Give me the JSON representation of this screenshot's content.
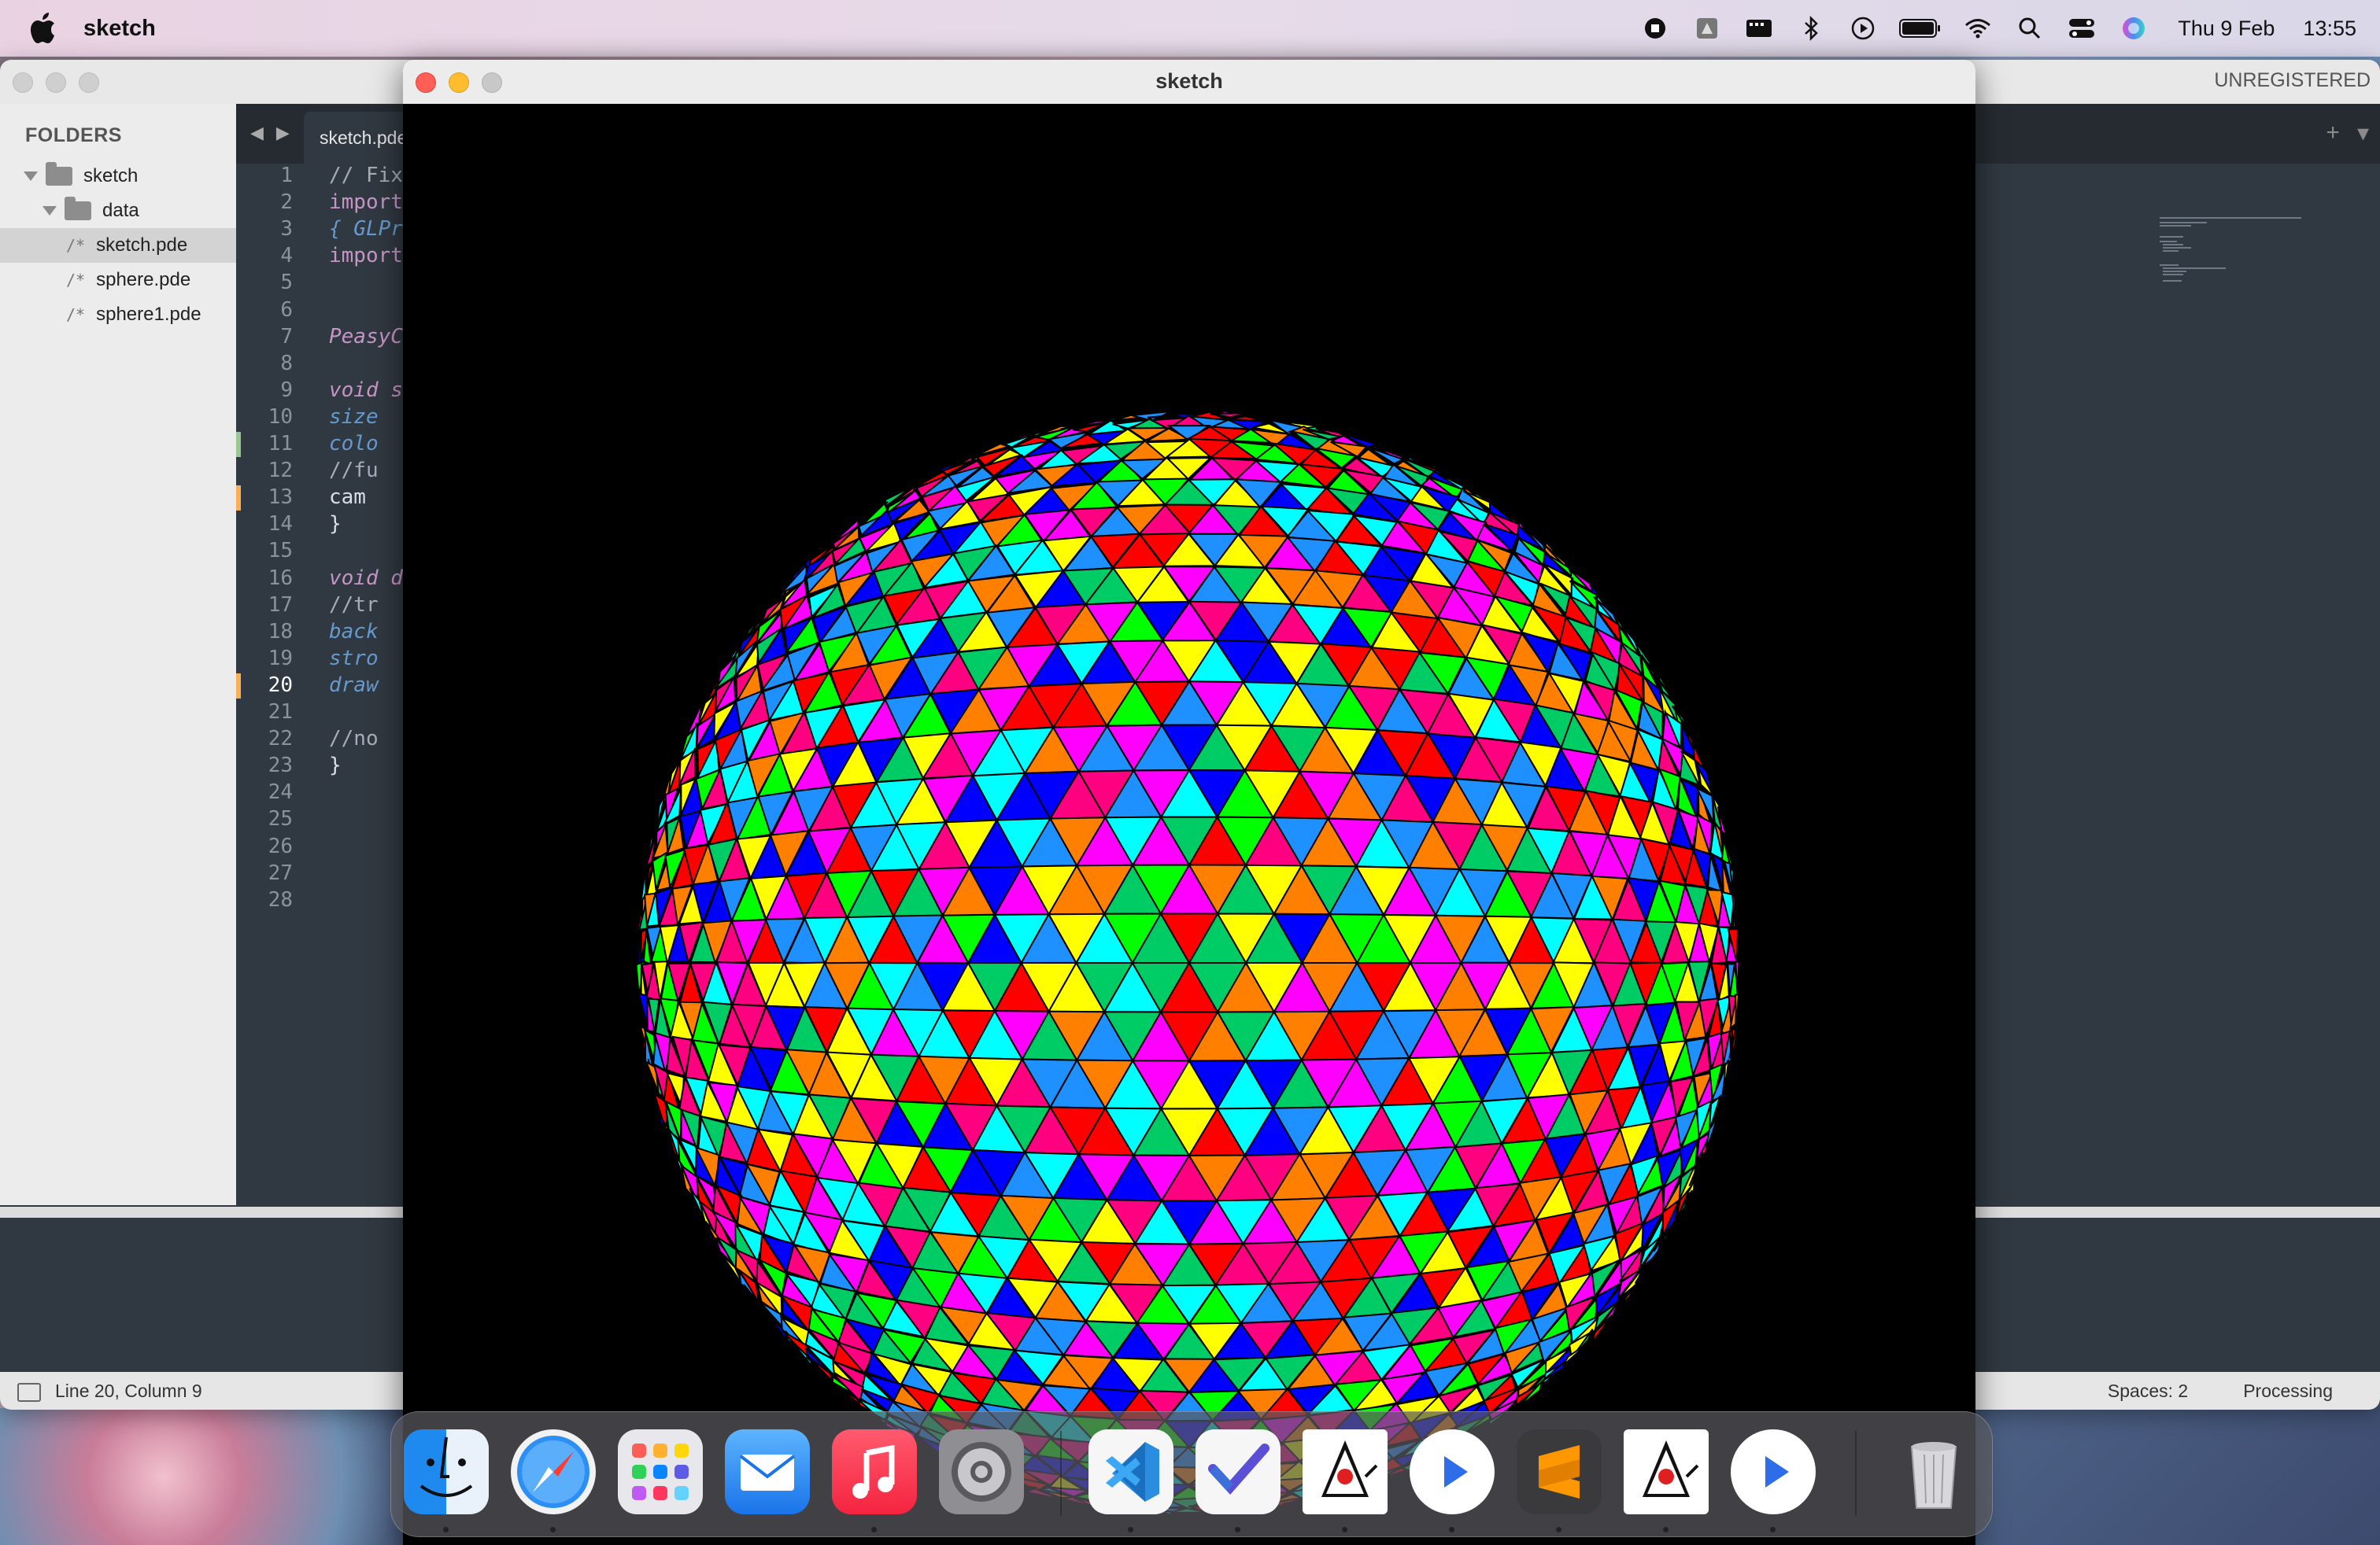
{
  "menubar": {
    "app_name": "sketch",
    "date": "Thu 9 Feb",
    "time": "13:55",
    "status_icons": [
      "screen-record-icon",
      "arc-icon",
      "display-icon",
      "bluetooth-icon",
      "play-icon",
      "battery-icon",
      "wifi-icon",
      "spotlight-icon",
      "control-center-icon",
      "siri-icon"
    ]
  },
  "editor": {
    "unregistered": "UNREGISTERED",
    "sidebar": {
      "title": "FOLDERS",
      "items": [
        {
          "label": "sketch",
          "type": "folder"
        },
        {
          "label": "data",
          "type": "folder"
        },
        {
          "label": "sketch.pde",
          "type": "file"
        },
        {
          "label": "sphere.pde",
          "type": "file"
        },
        {
          "label": "sphere1.pde",
          "type": "file"
        }
      ]
    },
    "tab": {
      "label": "sketch.pde"
    },
    "code_lines": [
      "// Fix",
      "import",
      "{ GLPr",
      "import",
      "",
      "",
      "PeasyC",
      "",
      "void s",
      "  size",
      "  colo",
      "  //fu",
      "  cam ",
      "}",
      "",
      "void d",
      "  //tr",
      "  back",
      "  stro",
      "  draw",
      "",
      "  //no",
      "}",
      "",
      "",
      "",
      "",
      ""
    ],
    "active_line": "20",
    "status": {
      "position": "Line 20, Column 9",
      "spaces": "Spaces: 2",
      "syntax": "Processing"
    }
  },
  "sketch_window": {
    "title": "sketch"
  },
  "dock": {
    "items": [
      "finder-icon",
      "safari-icon",
      "launchpad-icon",
      "mail-icon",
      "music-icon",
      "system-settings-icon",
      "vscode-icon",
      "visual-studio-icon",
      "java-duke-icon",
      "play-app-icon",
      "sublime-text-icon",
      "java-duke-icon-2",
      "play-app-icon-2",
      "trash-icon"
    ]
  },
  "colors": {
    "editor_bg": "#303841",
    "sidebar_bg": "#ececec",
    "accent_orange": "#f9ae58",
    "accent_green": "#99c794"
  }
}
